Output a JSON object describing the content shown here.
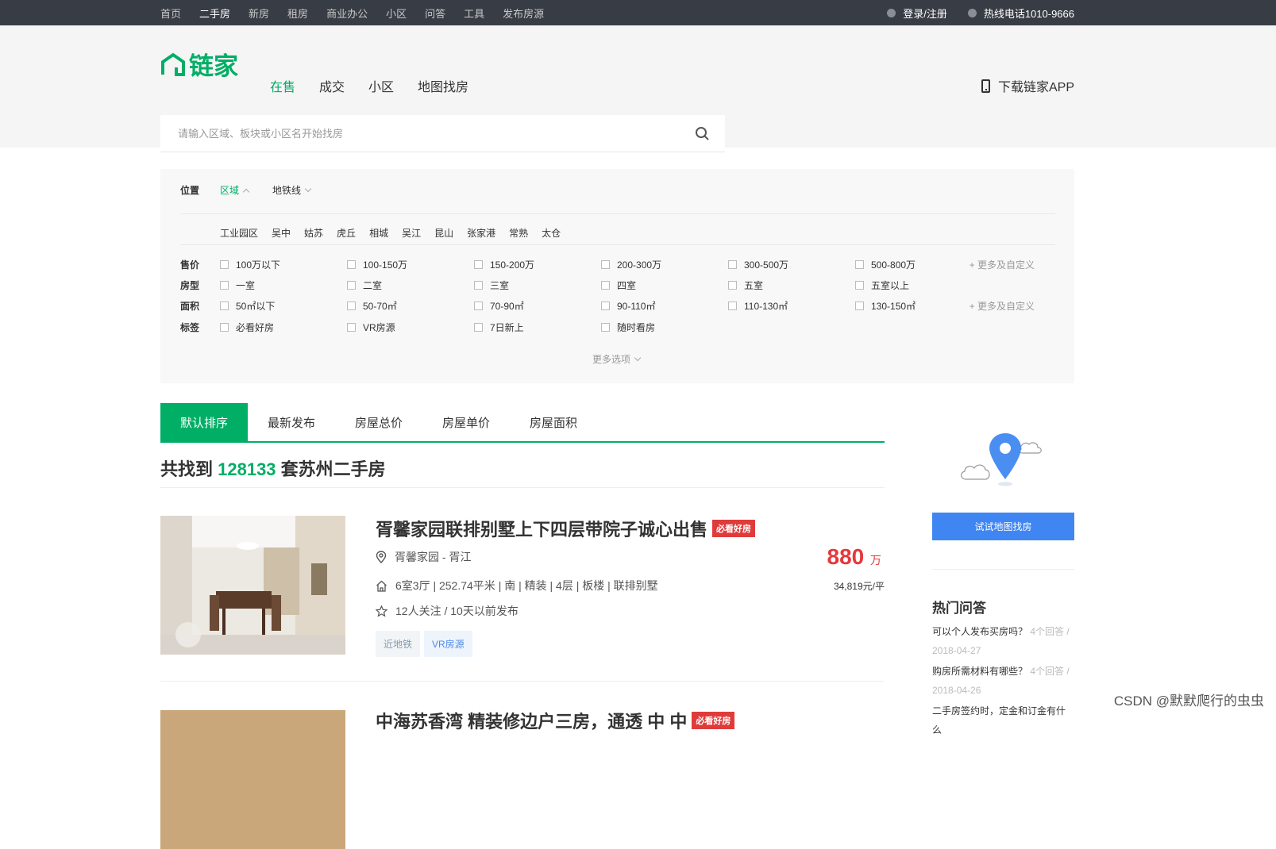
{
  "topbar": {
    "nav": [
      "首页",
      "二手房",
      "新房",
      "租房",
      "商业办公",
      "小区",
      "问答",
      "工具",
      "发布房源"
    ],
    "login": "登录/注册",
    "hotline": "热线电话1010-9666"
  },
  "header": {
    "logo_text": "链家",
    "nav": [
      "在售",
      "成交",
      "小区",
      "地图找房"
    ],
    "download": "下载链家APP",
    "search_placeholder": "请输入区域、板块或小区名开始找房"
  },
  "filter": {
    "location_label": "位置",
    "region_tab": "区域",
    "subway_tab": "地铁线",
    "districts": [
      "工业园区",
      "吴中",
      "姑苏",
      "虎丘",
      "相城",
      "吴江",
      "昆山",
      "张家港",
      "常熟",
      "太仓"
    ],
    "rows": [
      {
        "label": "售价",
        "options": [
          "100万以下",
          "100-150万",
          "150-200万",
          "200-300万",
          "300-500万",
          "500-800万"
        ],
        "more": "+ 更多及自定义"
      },
      {
        "label": "房型",
        "options": [
          "一室",
          "二室",
          "三室",
          "四室",
          "五室",
          "五室以上"
        ],
        "more": ""
      },
      {
        "label": "面积",
        "options": [
          "50㎡以下",
          "50-70㎡",
          "70-90㎡",
          "90-110㎡",
          "110-130㎡",
          "130-150㎡"
        ],
        "more": "+ 更多及自定义"
      },
      {
        "label": "标签",
        "options": [
          "必看好房",
          "VR房源",
          "7日新上",
          "随时看房"
        ],
        "more": ""
      }
    ],
    "more_options": "更多选项"
  },
  "sort_tabs": [
    "默认排序",
    "最新发布",
    "房屋总价",
    "房屋单价",
    "房屋面积"
  ],
  "result": {
    "prefix": "共找到 ",
    "count": "128133",
    "suffix": " 套苏州二手房"
  },
  "listings": [
    {
      "title": "胥馨家园联排别墅上下四层带院子诚心出售",
      "badge": "必看好房",
      "location": "胥馨家园 - 胥江",
      "house_info": "6室3厅 | 252.74平米 | 南 | 精装 | 4层 | 板楼 | 联排别墅",
      "follow_info": "12人关注 / 10天以前发布",
      "tags": [
        "近地铁",
        "VR房源"
      ],
      "price": "880",
      "price_unit": "万",
      "unit_price": "34,819元/平"
    },
    {
      "title": "中海苏香湾 精装修边户三房，通透 中 中",
      "badge": "必看好房"
    }
  ],
  "sidebar": {
    "map_button": "试试地图找房",
    "qa_title": "热门问答",
    "qa": [
      {
        "q": "可以个人发布买房吗？",
        "answers": "4个回答 /",
        "date": "2018-04-27"
      },
      {
        "q": "购房所需材料有哪些？",
        "answers": "4个回答 /",
        "date": "2018-04-26"
      },
      {
        "q": "二手房签约时，定金和订金有什么",
        "answers": "",
        "date": ""
      }
    ]
  },
  "watermark": "CSDN @默默爬行的虫虫",
  "colors": {
    "brand": "#00ae66",
    "price": "#e4393c",
    "map_button": "#3f86f3",
    "topbar": "#383d45"
  }
}
